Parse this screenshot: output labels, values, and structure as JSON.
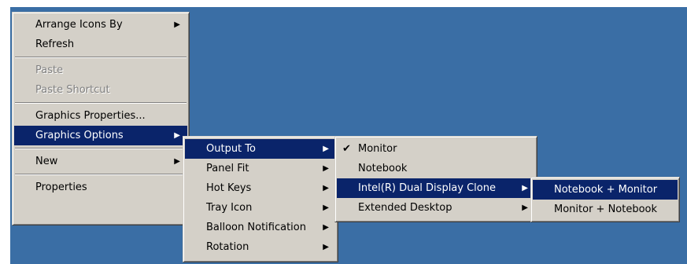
{
  "main_menu": {
    "arrange_icons_by": "Arrange Icons By",
    "refresh": "Refresh",
    "paste": "Paste",
    "paste_shortcut": "Paste Shortcut",
    "graphics_properties": "Graphics Properties...",
    "graphics_options": "Graphics Options",
    "new": "New",
    "properties": "Properties"
  },
  "graphics_options_menu": {
    "items": [
      "Output To",
      "Panel Fit",
      "Hot Keys",
      "Tray Icon",
      "Balloon Notification",
      "Rotation"
    ]
  },
  "output_to_menu": {
    "monitor": "Monitor",
    "notebook": "Notebook",
    "dual_display_clone": "Intel(R) Dual Display Clone",
    "extended_desktop": "Extended Desktop"
  },
  "clone_menu": {
    "items": [
      "Notebook + Monitor",
      "Monitor + Notebook"
    ]
  },
  "glyphs": {
    "arrow": "▶",
    "check": "✔"
  },
  "colors": {
    "desktop": "#3a6ea5",
    "menu": "#d4d0c8",
    "highlight": "#0a246a"
  }
}
